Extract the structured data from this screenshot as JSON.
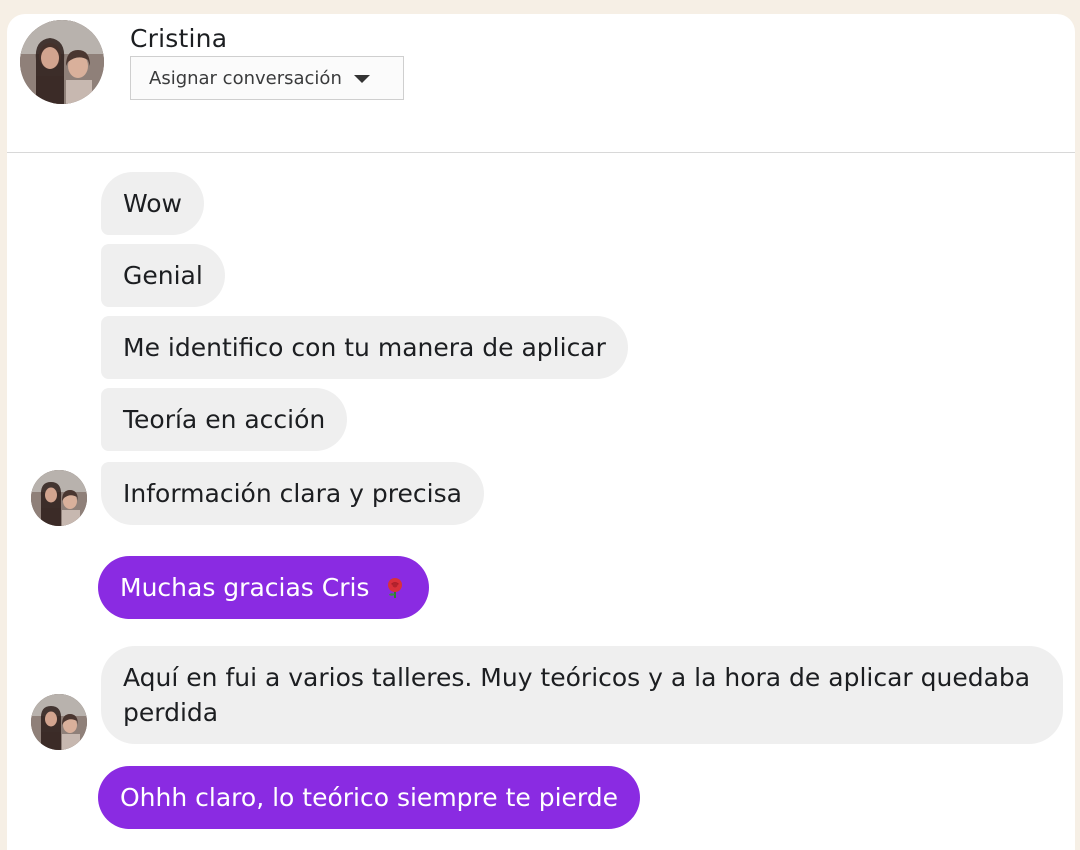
{
  "contact": {
    "name": "Cristina",
    "avatar_icon": "contact-photo-icon"
  },
  "header": {
    "assign_label": "Asignar conversación",
    "assign_icon": "caret-down-icon"
  },
  "messages": [
    {
      "direction": "in",
      "text": "Wow"
    },
    {
      "direction": "in",
      "text": "Genial"
    },
    {
      "direction": "in",
      "text": "Me identifico con tu manera de aplicar"
    },
    {
      "direction": "in",
      "text": "Teoría en acción"
    },
    {
      "direction": "in",
      "text": "Información clara y precisa"
    },
    {
      "direction": "out",
      "text": "Muchas gracias Cris",
      "emoji_icon": "rose-emoji-icon"
    },
    {
      "direction": "in",
      "text": "Aquí en fui a varios talleres. Muy teóricos y a la hora de aplicar quedaba perdida"
    },
    {
      "direction": "out",
      "text": "Ohhh claro, lo teórico siempre te pierde"
    }
  ],
  "colors": {
    "outgoing_bubble": "#8a2be2",
    "incoming_bubble": "#efefef",
    "page_background": "#f6efe5"
  }
}
